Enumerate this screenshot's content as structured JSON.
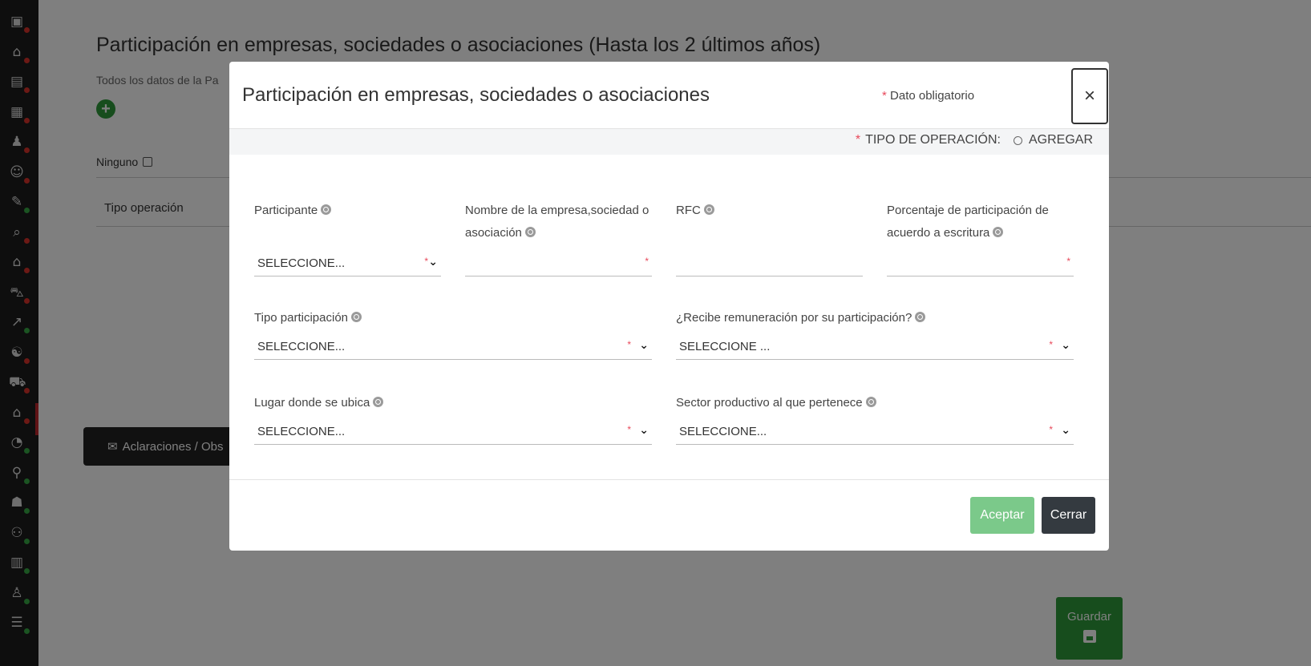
{
  "sidebar": {
    "items": [
      {
        "icon": "id-card-icon",
        "glyph": "▣",
        "status": "red"
      },
      {
        "icon": "home-info-icon",
        "glyph": "⌂",
        "status": "red"
      },
      {
        "icon": "document-icon",
        "glyph": "▤",
        "status": "red"
      },
      {
        "icon": "building-icon",
        "glyph": "▦",
        "status": "red"
      },
      {
        "icon": "people-link-icon",
        "glyph": "♟",
        "status": "red"
      },
      {
        "icon": "family-icon",
        "glyph": "☺",
        "status": "red"
      },
      {
        "icon": "edit-doc-icon",
        "glyph": "✎",
        "status": "green"
      },
      {
        "icon": "search-doc-icon",
        "glyph": "⌕",
        "status": "red"
      },
      {
        "icon": "house-icon",
        "glyph": "⌂",
        "status": "red"
      },
      {
        "icon": "car-icon",
        "glyph": "⛍",
        "status": "red"
      },
      {
        "icon": "chart-icon",
        "glyph": "↗",
        "status": "green"
      },
      {
        "icon": "handshake-icon",
        "glyph": "☯",
        "status": "red"
      },
      {
        "icon": "truck-icon",
        "glyph": "⛟",
        "status": "red"
      },
      {
        "icon": "house-pin-icon",
        "glyph": "⌂",
        "status": "red"
      },
      {
        "icon": "pie-chart-icon",
        "glyph": "◔",
        "status": "green"
      },
      {
        "icon": "network-icon",
        "glyph": "⚲",
        "status": "green"
      },
      {
        "icon": "group-icon",
        "glyph": "☗",
        "status": "green"
      },
      {
        "icon": "org-chart-icon",
        "glyph": "⚇",
        "status": "green"
      },
      {
        "icon": "board-icon",
        "glyph": "▥",
        "status": "green"
      },
      {
        "icon": "user-award-icon",
        "glyph": "♙",
        "status": "green"
      },
      {
        "icon": "checklist-icon",
        "glyph": "☰",
        "status": "green"
      }
    ],
    "colors": {
      "red": "#d9332a",
      "green": "#37a844"
    }
  },
  "page": {
    "title": "Participación en empresas, sociedades o asociaciones (Hasta los 2 últimos años)",
    "subtitle": "Todos los datos de la Pa",
    "ninguno_label": "Ninguno",
    "table_header": "Tipo operación",
    "aclaraciones_label": "Aclaraciones / Obs",
    "guardar_label": "Guardar"
  },
  "modal": {
    "title": "Participación en empresas, sociedades o asociaciones",
    "required_note": "Dato obligatorio",
    "required_mark": "*",
    "close_label": "×",
    "operation_label": "TIPO DE OPERACIÓN:",
    "operation_value": "AGREGAR",
    "fields": {
      "participante": {
        "label": "Participante",
        "value": "SELECCIONE..."
      },
      "nombre_empresa": {
        "label": "Nombre de la empresa,sociedad o asociación",
        "value": ""
      },
      "rfc": {
        "label": "RFC",
        "value": ""
      },
      "porcentaje": {
        "label": "Porcentaje de participación de acuerdo a escritura",
        "value": ""
      },
      "tipo_participacion": {
        "label": "Tipo participación",
        "value": "SELECCIONE..."
      },
      "recibe_remuneracion": {
        "label": "¿Recibe remuneración por su participación?",
        "value": "SELECCIONE ..."
      },
      "lugar_ubica": {
        "label": "Lugar donde se ubica",
        "value": "SELECCIONE..."
      },
      "sector_productivo": {
        "label": "Sector productivo al que pertenece",
        "value": "SELECCIONE..."
      }
    },
    "aceptar_label": "Aceptar",
    "cerrar_label": "Cerrar"
  }
}
